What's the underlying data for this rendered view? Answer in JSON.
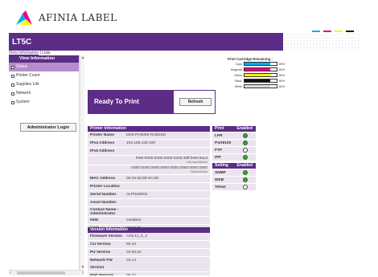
{
  "brand": {
    "logo_text": "AFINIA LABEL",
    "colors": {
      "cyan": "#00aeef",
      "magenta": "#ec008c",
      "yellow": "#fff200",
      "purple": "#5b2d86"
    }
  },
  "header": {
    "title": "LT5C"
  },
  "breadcrumb": {
    "link": "View Information",
    "sep": " | ",
    "current": "Lists"
  },
  "sidebar": {
    "heading": "View Information",
    "items": [
      {
        "label": "Status",
        "active": true
      },
      {
        "label": "Printer Count",
        "active": false
      },
      {
        "label": "Supplies Life",
        "active": false
      },
      {
        "label": "Network",
        "active": false
      },
      {
        "label": "System",
        "active": false
      }
    ],
    "admin_button": "Administrator Login"
  },
  "status": {
    "text": "Ready To Print",
    "refresh_label": "Refresh"
  },
  "cartridges": {
    "title": "Print Cartridge Remaining :",
    "items": [
      {
        "name": "Cyan",
        "percent": 80,
        "color": "#00aeef",
        "label": "80%"
      },
      {
        "name": "Magenta",
        "percent": 80,
        "color": "#ec008c",
        "label": "80%"
      },
      {
        "name": "Yellow",
        "percent": 80,
        "color": "#fff200",
        "label": "80%"
      },
      {
        "name": "Black",
        "percent": 80,
        "color": "#111111",
        "label": "80%"
      },
      {
        "name": "White",
        "percent": 80,
        "color": "#dddddd",
        "label": "80%"
      }
    ]
  },
  "printer_info": {
    "heading": "Printer Information",
    "rows": [
      {
        "label": "Printer Name",
        "value": "DK5-PH9359-RGB16D"
      },
      {
        "label": "IPv4 Address",
        "value": "192.168.100.100"
      },
      {
        "label": "IPv6 Address",
        "value": ""
      },
      {
        "label": "",
        "value": "fe80:0000:0000:0000:0225:36ff:fe9e:8acd",
        "sub": "Link-local Address",
        "right": true
      },
      {
        "label": "",
        "value": "0000:0000:0000:0000:0000:0000:0000:0000",
        "sub": "Global Address",
        "right": true
      },
      {
        "label": "MAC Address",
        "value": "00:25:36:9E:8A:9D"
      },
      {
        "label": "Printer Location",
        "value": ""
      },
      {
        "label": "Serial Number",
        "value": "ALPI620004"
      },
      {
        "label": "Asset Number",
        "value": ""
      },
      {
        "label": "Contact Name - Administrator",
        "value": ""
      },
      {
        "label": "HDD",
        "value": "Installed"
      },
      {
        "label": "RAM",
        "value": "2048MB"
      }
    ]
  },
  "version_info": {
    "heading": "Version Information",
    "rows": [
      {
        "label": "Firmware Version",
        "value": "AA5.11_0_4"
      },
      {
        "label": "CU Version",
        "value": "99.32"
      },
      {
        "label": "PU Version",
        "value": "03.06.62"
      },
      {
        "label": "Network FW Version",
        "value": "03.14"
      },
      {
        "label": "Web Remote Version",
        "value": "08.22"
      }
    ]
  },
  "print_service": {
    "heading": "Print Service",
    "status_heading": "Enabled",
    "rows": [
      {
        "name": "LPR",
        "enabled": true
      },
      {
        "name": "Port9100",
        "enabled": true
      },
      {
        "name": "FTP",
        "enabled": false
      },
      {
        "name": "IPP",
        "enabled": true
      }
    ]
  },
  "setting_service": {
    "heading": "Setting Service",
    "status_heading": "Enabled",
    "rows": [
      {
        "name": "SNMP",
        "enabled": true
      },
      {
        "name": "WEB",
        "enabled": true
      },
      {
        "name": "Telnet",
        "enabled": false
      }
    ]
  }
}
